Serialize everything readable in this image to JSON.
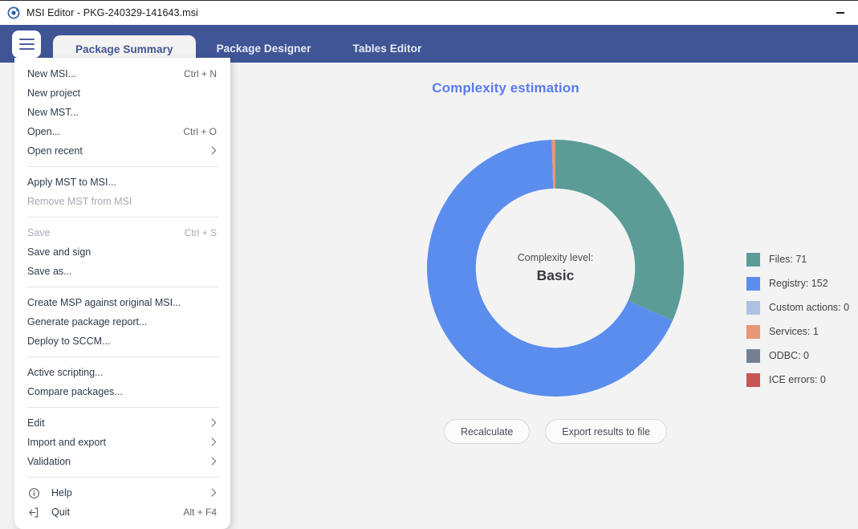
{
  "window": {
    "title": "MSI Editor - PKG-240329-141643.msi",
    "logo_icon": "msi-editor-logo-icon",
    "minimize_label": "–"
  },
  "navbar": {
    "menu_button_icon": "hamburger-menu-icon",
    "tabs": [
      {
        "label": "Package Summary",
        "active": true
      },
      {
        "label": "Package Designer",
        "active": false
      },
      {
        "label": "Tables Editor",
        "active": false
      }
    ]
  },
  "menu": {
    "sections": [
      {
        "items": [
          {
            "label": "New MSI...",
            "shortcut": "Ctrl + N",
            "disabled": false,
            "submenu": false
          },
          {
            "label": "New project",
            "shortcut": "",
            "disabled": false,
            "submenu": false
          },
          {
            "label": "New MST...",
            "shortcut": "",
            "disabled": false,
            "submenu": false
          },
          {
            "label": "Open...",
            "shortcut": "Ctrl + O",
            "disabled": false,
            "submenu": false
          },
          {
            "label": "Open recent",
            "shortcut": "",
            "disabled": false,
            "submenu": true
          }
        ]
      },
      {
        "items": [
          {
            "label": "Apply MST to MSI...",
            "shortcut": "",
            "disabled": false,
            "submenu": false
          },
          {
            "label": "Remove MST from MSI",
            "shortcut": "",
            "disabled": true,
            "submenu": false
          }
        ]
      },
      {
        "items": [
          {
            "label": "Save",
            "shortcut": "Ctrl + S",
            "disabled": true,
            "submenu": false
          },
          {
            "label": "Save and sign",
            "shortcut": "",
            "disabled": false,
            "submenu": false
          },
          {
            "label": "Save as...",
            "shortcut": "",
            "disabled": false,
            "submenu": false
          }
        ]
      },
      {
        "items": [
          {
            "label": "Create MSP against original MSI...",
            "shortcut": "",
            "disabled": false,
            "submenu": false
          },
          {
            "label": "Generate package report...",
            "shortcut": "",
            "disabled": false,
            "submenu": false
          },
          {
            "label": "Deploy to SCCM...",
            "shortcut": "",
            "disabled": false,
            "submenu": false
          }
        ]
      },
      {
        "items": [
          {
            "label": "Active scripting...",
            "shortcut": "",
            "disabled": false,
            "submenu": false
          },
          {
            "label": "Compare packages...",
            "shortcut": "",
            "disabled": false,
            "submenu": false
          }
        ]
      },
      {
        "items": [
          {
            "label": "Edit",
            "shortcut": "",
            "disabled": false,
            "submenu": true
          },
          {
            "label": "Import and export",
            "shortcut": "",
            "disabled": false,
            "submenu": true
          },
          {
            "label": "Validation",
            "shortcut": "",
            "disabled": false,
            "submenu": true
          }
        ]
      },
      {
        "items": [
          {
            "label": "Help",
            "shortcut": "",
            "disabled": false,
            "submenu": true,
            "icon": "info-circle-icon"
          },
          {
            "label": "Quit",
            "shortcut": "Alt + F4",
            "disabled": false,
            "submenu": false,
            "icon": "exit-arrow-icon"
          }
        ]
      }
    ]
  },
  "main": {
    "title": "Complexity estimation",
    "center_label": "Complexity level:",
    "center_value": "Basic",
    "buttons": [
      {
        "label": "Recalculate",
        "name": "recalculate-button"
      },
      {
        "label": "Export results to file",
        "name": "export-results-button"
      }
    ]
  },
  "chart_data": {
    "type": "pie",
    "variant": "donut",
    "title": "Complexity estimation",
    "center_text": "Complexity level: Basic",
    "start_angle": -90,
    "direction": "clockwise",
    "inner_radius_ratio": 0.62,
    "legend_position": "right",
    "total": 224,
    "categories": [
      "Files",
      "Registry",
      "Custom actions",
      "Services",
      "ODBC",
      "ICE errors"
    ],
    "values": [
      71,
      152,
      0,
      1,
      0,
      0
    ],
    "colors": [
      "#5b9c97",
      "#5b8def",
      "#adc2e0",
      "#e99677",
      "#74808f",
      "#c85556"
    ],
    "legend_labels": [
      "Files: 71",
      "Registry: 152",
      "Custom actions: 0",
      "Services: 1",
      "ODBC: 0",
      "ICE errors: 0"
    ]
  },
  "theme": {
    "navbar_bg": "#3f5596",
    "content_bg": "#f3f3f3",
    "title_accent": "#5b7ce8",
    "tab_active_text": "#41558f"
  }
}
